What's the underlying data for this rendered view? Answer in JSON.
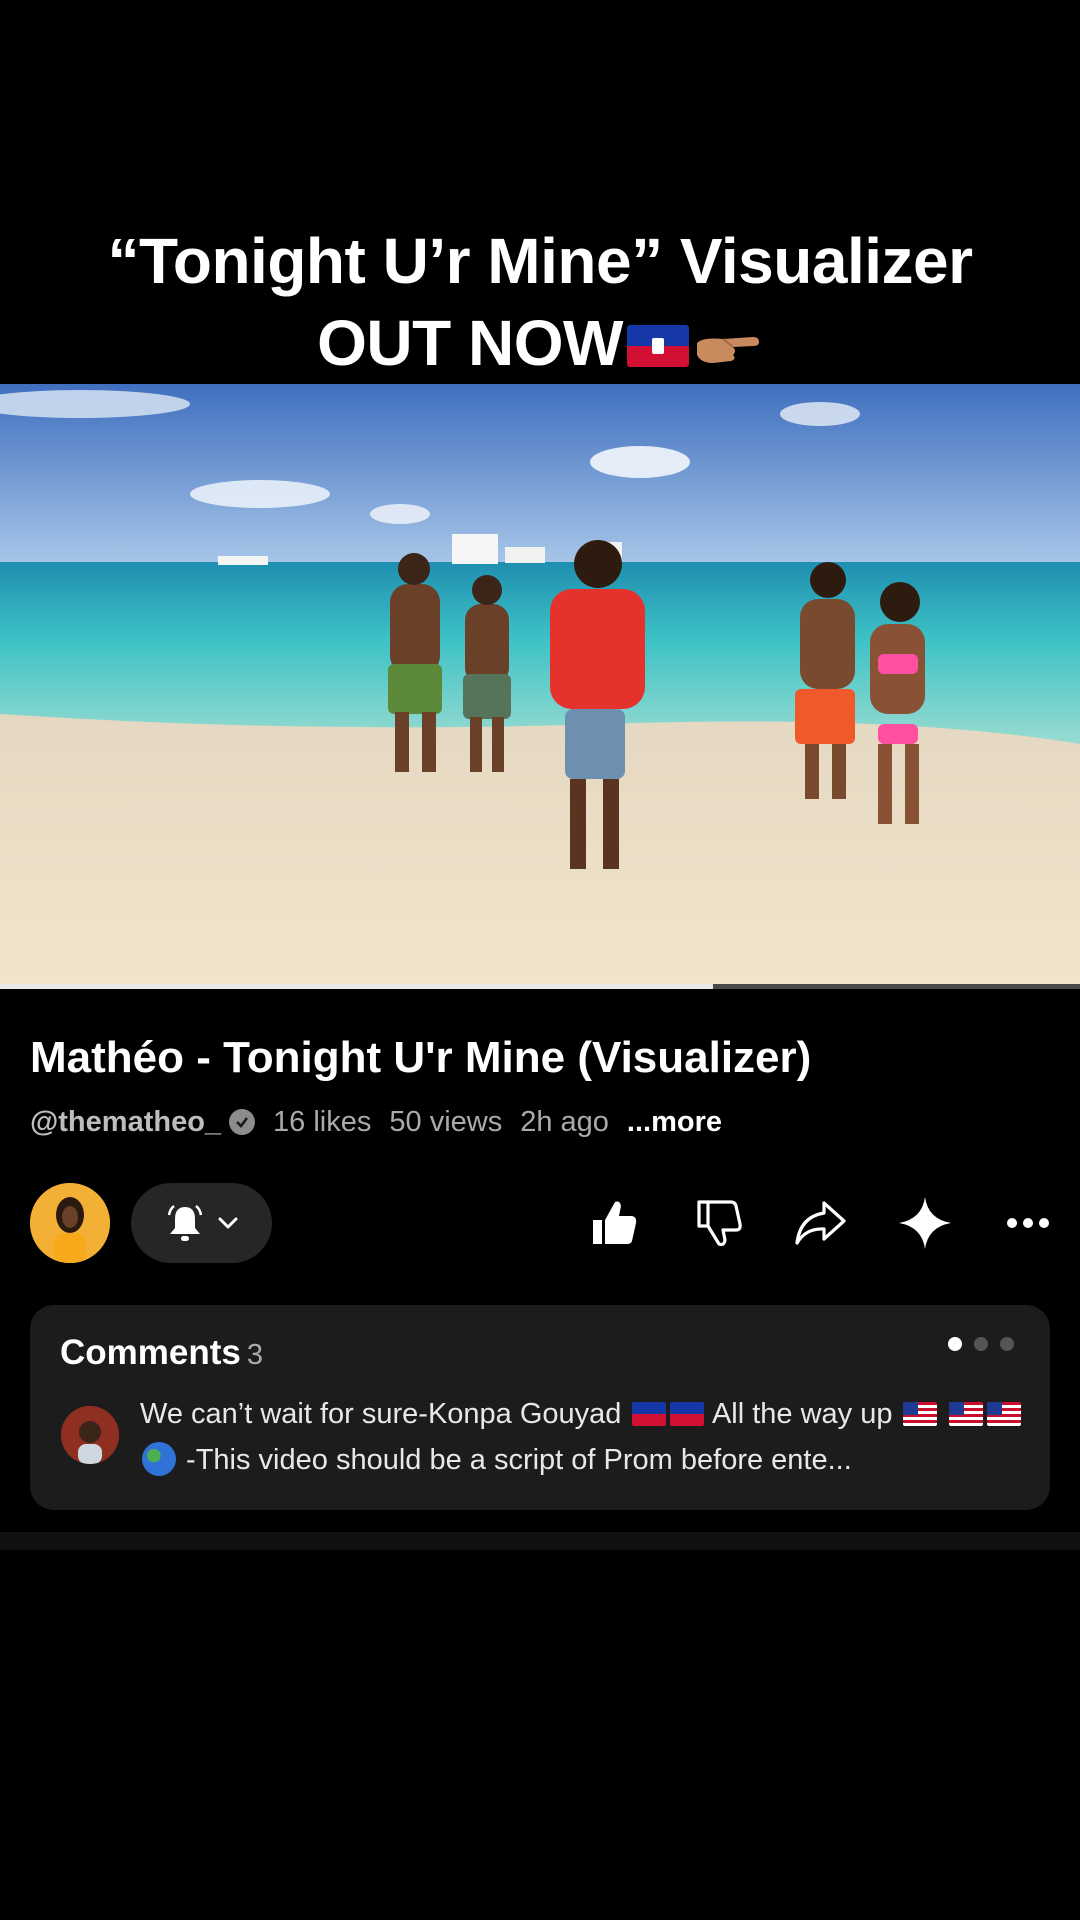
{
  "caption": {
    "line1": "“Tonight U’r Mine” Visualizer",
    "line2": "OUT NOW"
  },
  "video": {
    "progress_fraction": 0.66
  },
  "info": {
    "title": "Mathéo - Tonight U'r Mine (Visualizer)",
    "handle": "@thematheo_",
    "likes": "16 likes",
    "views": "50 views",
    "age": "2h ago",
    "more": "...more"
  },
  "actions": {
    "icons": [
      "bell-icon",
      "chevron-down-icon",
      "thumbs-up-icon",
      "thumbs-down-icon",
      "share-icon",
      "sparkle-icon",
      "more-icon"
    ]
  },
  "comments": {
    "heading": "Comments",
    "count": "3",
    "pages_total": 3,
    "page_active": 1,
    "preview_part1": "We can’t wait for sure-Konpa Gouyad ",
    "preview_part2": " All the way up ",
    "preview_part3": " -This video should be a script of Prom before ente..."
  },
  "colors": {
    "background": "#000000",
    "card": "#1c1c1c",
    "pill": "#262626",
    "muted_text": "#aaaaaa"
  }
}
